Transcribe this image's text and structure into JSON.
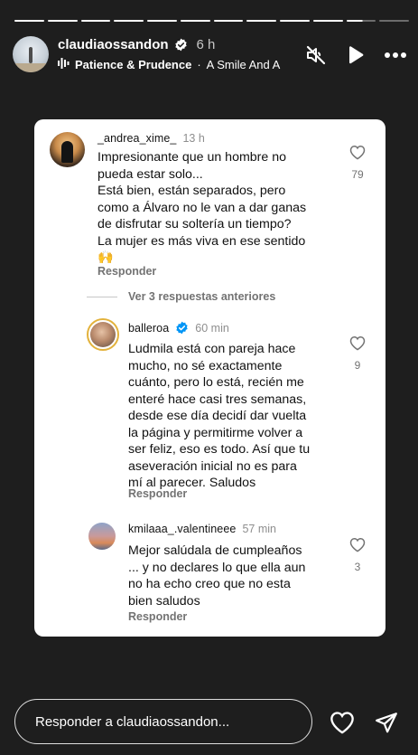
{
  "story": {
    "segments": 12,
    "completed_segments": 10,
    "active_segment_index": 10,
    "username": "claudiaossandon",
    "time": "6 h",
    "music_artist": "Patience & Prudence",
    "music_separator": "·",
    "music_song": "A Smile And A"
  },
  "comments": [
    {
      "username": "_andrea_xime_",
      "time": "13 h",
      "text": "Impresionante que un hombre no\npueda estar solo...\nEstá bien, están separados, pero\ncomo a Álvaro no le van a dar ganas\nde disfrutar su soltería un tiempo?\nLa mujer es más viva en ese sentido\n🙌",
      "likes": "79",
      "reply_label": "Responder"
    },
    {
      "username": "balleroa",
      "time": "60 min",
      "text": "Ludmila está con pareja hace\nmucho, no sé exactamente\ncuánto, pero lo está, recién me\nenteré hace casi tres semanas,\ndesde ese día decidí dar vuelta\nla página y permitirme volver a\nser feliz, eso es todo. Así que tu\naseveración inicial no es para\nmí al parecer. Saludos",
      "likes": "9",
      "reply_label": "Responder"
    },
    {
      "username": "kmilaaa_.valentineee",
      "time": "57 min",
      "text": "Mejor salúdala de cumpleaños\n... y no declares lo que ella aun\nno ha echo creo que no esta\nbien saludos",
      "likes": "3",
      "reply_label": "Responder"
    }
  ],
  "view_more_label": "Ver 3 respuestas anteriores",
  "bottom": {
    "reply_placeholder": "Responder a claudiaossandon..."
  },
  "colors": {
    "background": "#1e1e1e",
    "card": "#ffffff",
    "verified": "#0095f6",
    "muted_text": "#737373"
  },
  "icons": [
    "speaker-muted-icon",
    "play-icon",
    "more-icon",
    "heart-icon",
    "send-icon",
    "verified-icon",
    "music-bars-icon"
  ]
}
